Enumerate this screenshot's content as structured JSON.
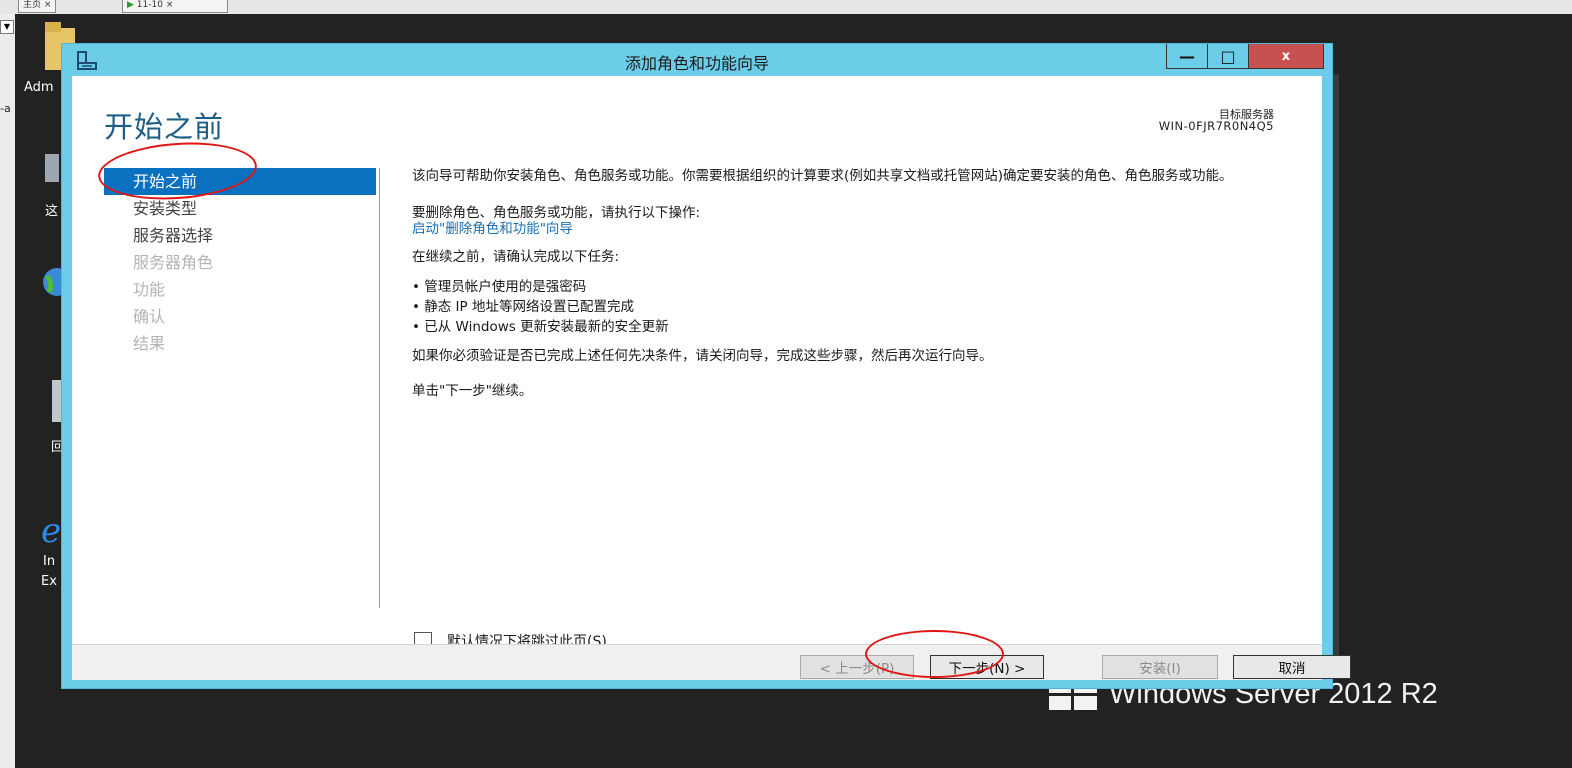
{
  "host": {
    "tab_labels": [
      "主页",
      "11-10"
    ],
    "left_fragment": "-a"
  },
  "desktop": {
    "icon_labels": [
      "Adm",
      "这",
      "回",
      "In",
      "Ex"
    ],
    "brand_text": "Windows Server 2012 R2"
  },
  "window": {
    "title": "添加角色和功能向导",
    "controls": {
      "minimize": "—",
      "maximize": "□",
      "close": "x"
    }
  },
  "page": {
    "heading": "开始之前",
    "target_server_label": "目标服务器",
    "target_server_name": "WIN-0FJR7R0N4Q5"
  },
  "nav": {
    "items": [
      {
        "label": "开始之前",
        "state": "active"
      },
      {
        "label": "安装类型",
        "state": "enabled"
      },
      {
        "label": "服务器选择",
        "state": "enabled"
      },
      {
        "label": "服务器角色",
        "state": "disabled"
      },
      {
        "label": "功能",
        "state": "disabled"
      },
      {
        "label": "确认",
        "state": "disabled"
      },
      {
        "label": "结果",
        "state": "disabled"
      }
    ]
  },
  "content": {
    "intro": "该向导可帮助你安装角色、角色服务或功能。你需要根据组织的计算要求(例如共享文档或托管网站)确定要安装的角色、角色服务或功能。",
    "remove_instruction": "要删除角色、角色服务或功能，请执行以下操作:",
    "remove_link": "启动\"删除角色和功能\"向导",
    "before_continue": "在继续之前，请确认完成以下任务:",
    "tasks": [
      "• 管理员帐户使用的是强密码",
      "• 静态 IP 地址等网络设置已配置完成",
      "• 已从 Windows 更新安装最新的安全更新"
    ],
    "if_verify": "如果你必须验证是否已完成上述任何先决条件，请关闭向导，完成这些步骤，然后再次运行向导。",
    "click_next": "单击\"下一步\"继续。",
    "skip_checkbox_label": "默认情况下将跳过此页(S)"
  },
  "buttons": {
    "back": "< 上一步(P)",
    "next": "下一步(N) >",
    "install": "安装(I)",
    "cancel": "取消"
  },
  "colors": {
    "title_bar": "#6ccde8",
    "active_nav": "#0a70c0",
    "heading": "#1d5e86",
    "link": "#1a6fb5",
    "annotation": "#e01515"
  }
}
